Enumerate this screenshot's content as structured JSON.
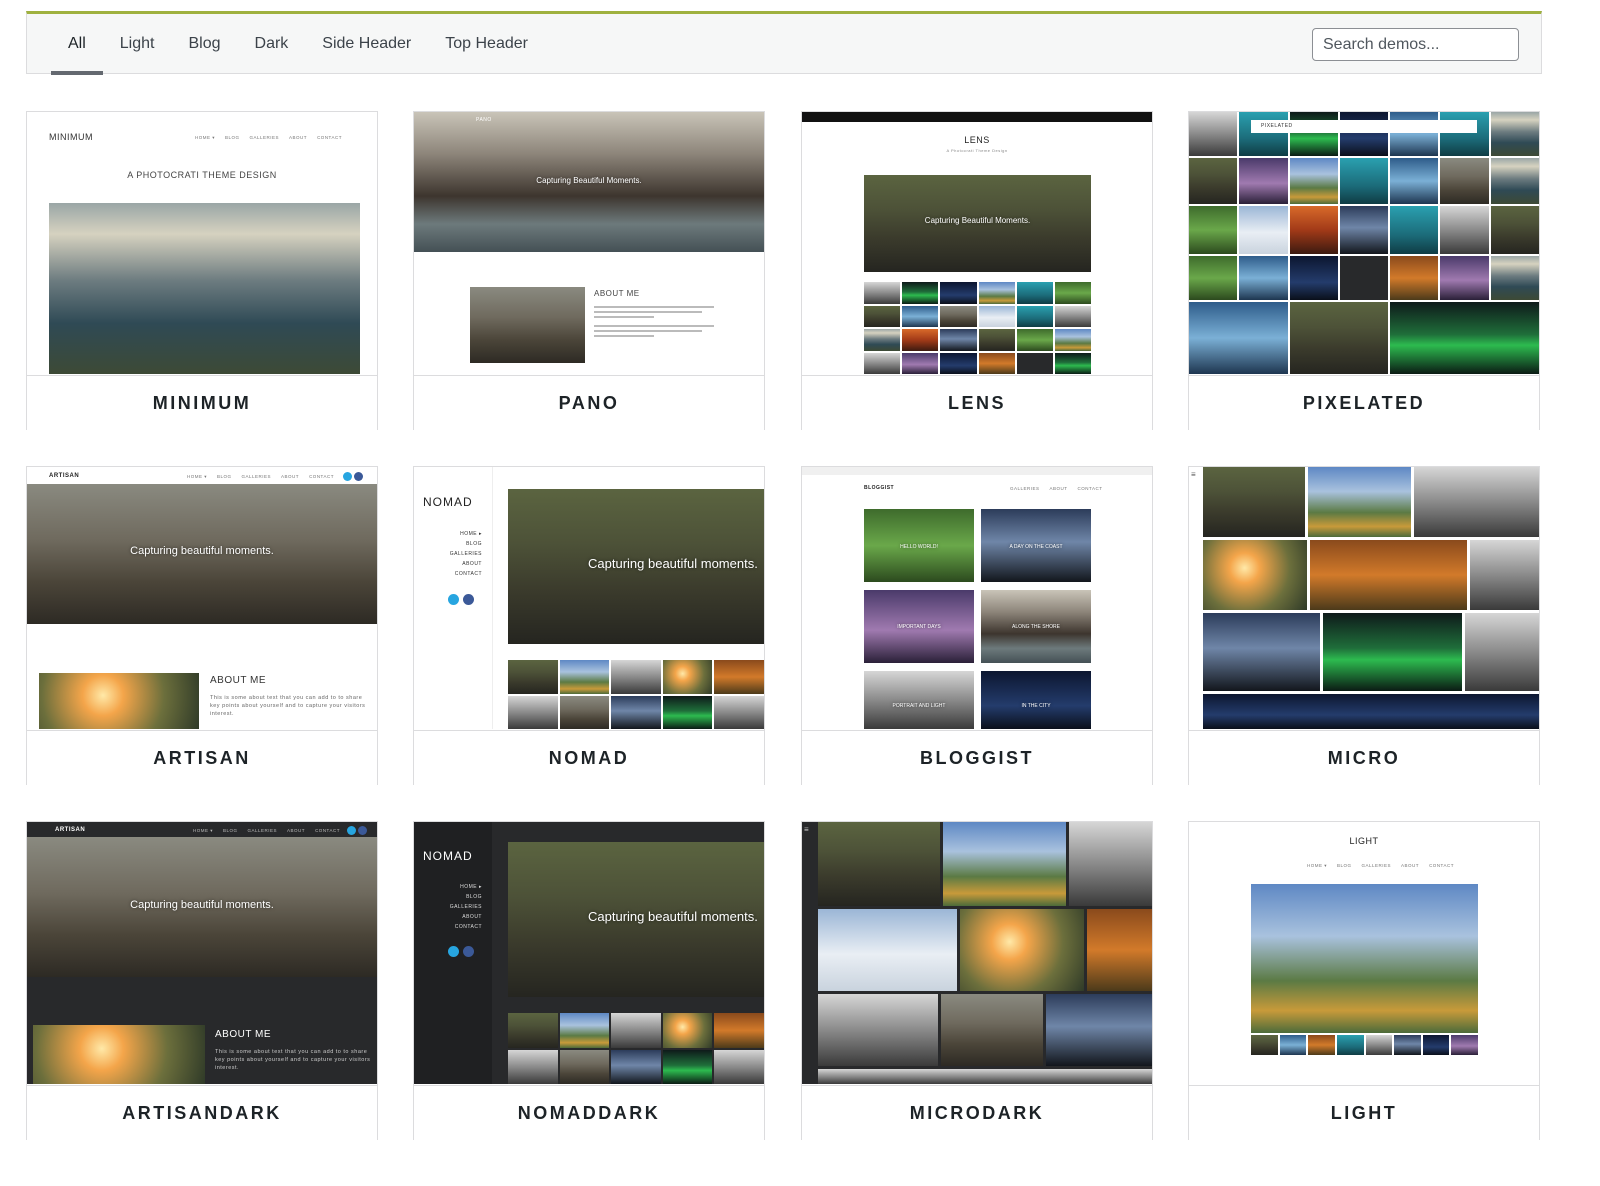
{
  "filter": {
    "tabs": [
      {
        "label": "All",
        "active": true
      },
      {
        "label": "Light",
        "active": false
      },
      {
        "label": "Blog",
        "active": false
      },
      {
        "label": "Dark",
        "active": false
      },
      {
        "label": "Side Header",
        "active": false
      },
      {
        "label": "Top Header",
        "active": false
      }
    ],
    "search_placeholder": "Search demos..."
  },
  "colors": {
    "accent_top_border": "#9fb13f",
    "active_tab_underline": "#646970",
    "dark_theme_bg": "#28292b"
  },
  "demos": [
    {
      "name": "MINIMUM",
      "thumb": {
        "logo": "MINIMUM",
        "tagline": "A PHOTOCRATI THEME DESIGN",
        "nav": [
          "HOME ▾",
          "BLOG",
          "GALLERIES",
          "ABOUT",
          "CONTACT"
        ]
      }
    },
    {
      "name": "PANO",
      "thumb": {
        "logo": "PANO",
        "hero_text": "Capturing Beautiful Moments.",
        "about_heading": "ABOUT ME",
        "nav": [
          "HOME ▾",
          "BLOG",
          "GALLERIES",
          "ABOUT",
          "CONTACT"
        ]
      }
    },
    {
      "name": "LENS",
      "thumb": {
        "logo": "LENS",
        "tagline": "A Photocrati Theme Design",
        "hero_text": "Capturing Beautiful Moments.",
        "nav": [
          "HOME ▾",
          "BLOG",
          "GALLERIES",
          "ABOUT",
          "CONTACT"
        ]
      }
    },
    {
      "name": "PIXELATED",
      "thumb": {
        "logo": "PIXELATED",
        "nav": [
          "HOME ▾",
          "BLOG",
          "GALLERIES",
          "ABOUT",
          "CONTACT"
        ]
      }
    },
    {
      "name": "ARTISAN",
      "thumb": {
        "logo": "ARTISAN",
        "hero_text": "Capturing beautiful moments.",
        "about_heading": "ABOUT ME",
        "about_text": "This is some about text that you can add to to share key points about yourself and to capture your visitors interest.",
        "nav": [
          "HOME ▾",
          "BLOG",
          "GALLERIES",
          "ABOUT",
          "CONTACT"
        ]
      }
    },
    {
      "name": "NOMAD",
      "thumb": {
        "logo": "NOMAD",
        "hero_text": "Capturing beautiful moments.",
        "menu": [
          "HOME ▸",
          "BLOG",
          "GALLERIES",
          "ABOUT",
          "CONTACT"
        ]
      }
    },
    {
      "name": "BLOGGIST",
      "thumb": {
        "logo": "BLOGGIST",
        "nav": [
          "GALLERIES",
          "ABOUT",
          "CONTACT"
        ],
        "posts": [
          "HELLO WORLD!",
          "A DAY ON THE COAST",
          "IMPORTANT DAYS",
          "ALONG THE SHORE",
          "PORTRAIT AND LIGHT",
          "IN THE CITY"
        ]
      }
    },
    {
      "name": "MICRO",
      "thumb": {}
    },
    {
      "name": "ARTISANDARK",
      "thumb": {
        "logo": "ARTISAN",
        "hero_text": "Capturing beautiful moments.",
        "about_heading": "ABOUT ME",
        "about_text": "This is some about text that you can add to to share key points about yourself and to capture your visitors interest.",
        "nav": [
          "HOME ▾",
          "BLOG",
          "GALLERIES",
          "ABOUT",
          "CONTACT"
        ]
      }
    },
    {
      "name": "NOMADDARK",
      "thumb": {
        "logo": "NOMAD",
        "hero_text": "Capturing beautiful moments.",
        "menu": [
          "HOME ▸",
          "BLOG",
          "GALLERIES",
          "ABOUT",
          "CONTACT"
        ]
      }
    },
    {
      "name": "MICRODARK",
      "thumb": {}
    },
    {
      "name": "LIGHT",
      "thumb": {
        "logo": "LIGHT",
        "nav": [
          "HOME ▾",
          "BLOG",
          "GALLERIES",
          "ABOUT",
          "CONTACT"
        ]
      }
    }
  ]
}
